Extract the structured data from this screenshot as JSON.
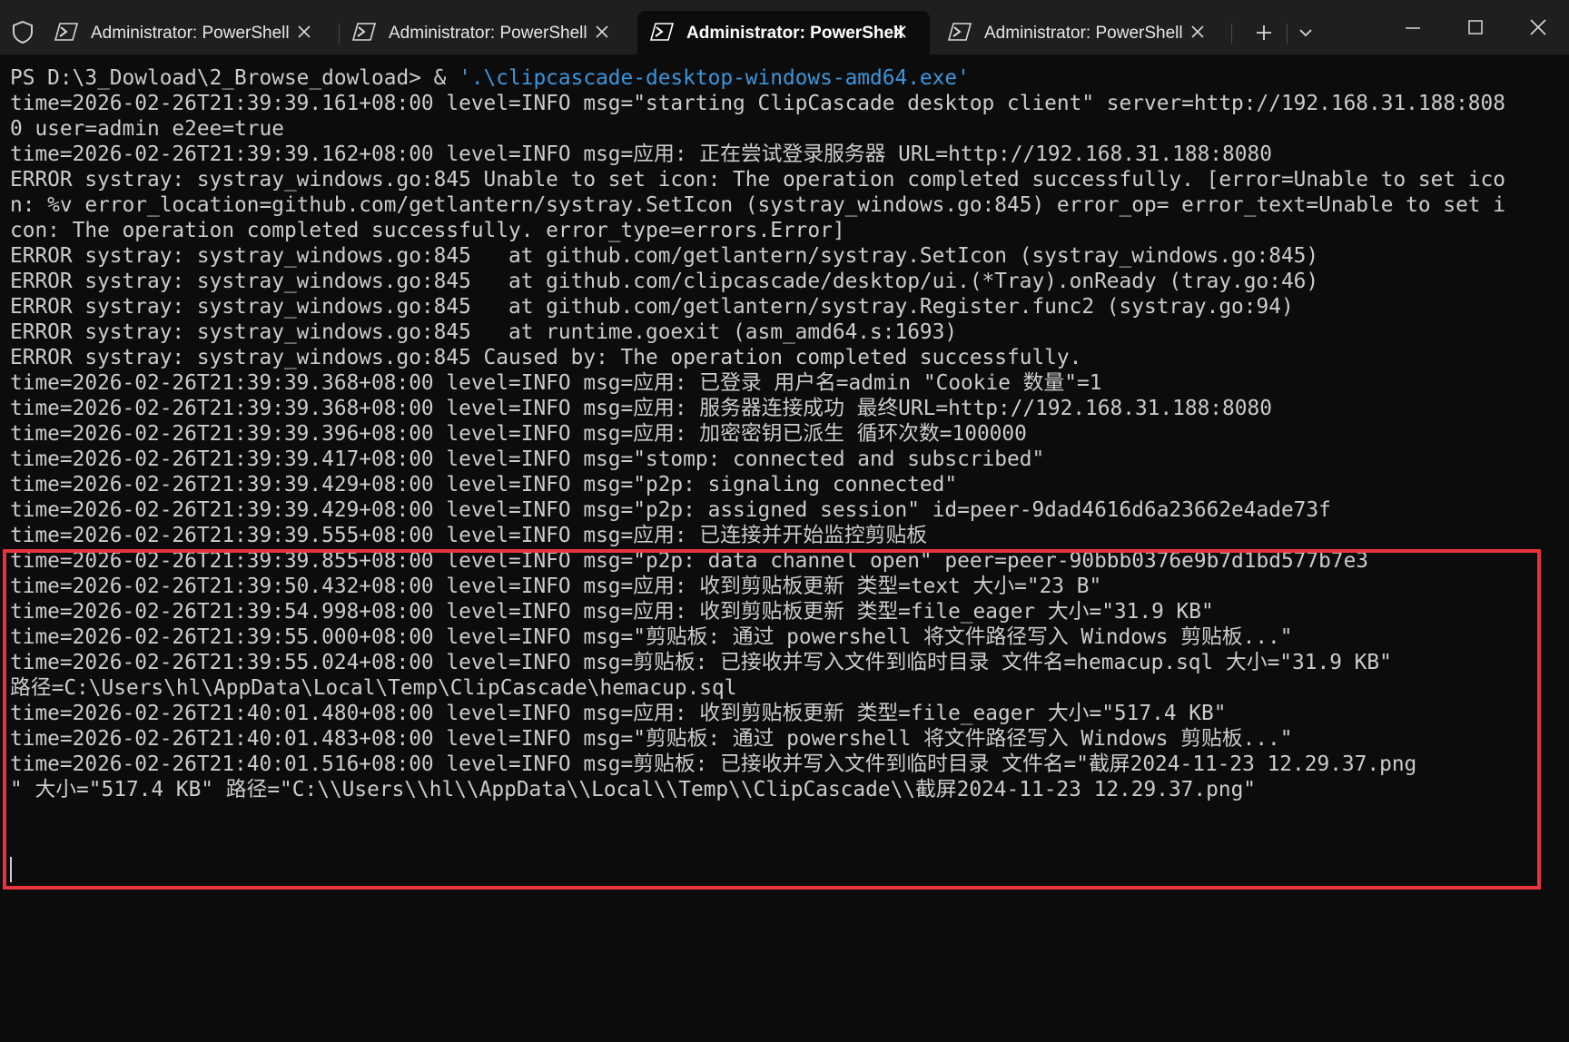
{
  "window": {
    "tabs": [
      {
        "label": "Administrator: PowerShell",
        "active": false
      },
      {
        "label": "Administrator: PowerShell",
        "active": false
      },
      {
        "label": "Administrator: PowerShell",
        "active": true
      },
      {
        "label": "Administrator: PowerShell",
        "active": false
      }
    ],
    "icons": {
      "shield": "shield-icon",
      "tab_icon": "powershell-icon",
      "close": "close-icon",
      "new_tab": "plus-icon",
      "dropdown": "chevron-down-icon",
      "minimize": "minimize-icon",
      "maximize": "maximize-icon",
      "close_window": "close-icon"
    },
    "colors": {
      "titlebar": "#1f1f1f",
      "terminal_bg": "#0c0c0c",
      "text": "#cccccc",
      "command_arg": "#3a96dd",
      "highlight_border": "#e5343d"
    }
  },
  "terminal": {
    "prompt": "PS D:\\3_Dowload\\2_Browse_dowload> & ",
    "command_arg": "'.\\clipcascade-desktop-windows-amd64.exe'",
    "lines": [
      "time=2026-02-26T21:39:39.161+08:00 level=INFO msg=\"starting ClipCascade desktop client\" server=http://192.168.31.188:808",
      "0 user=admin e2ee=true",
      "time=2026-02-26T21:39:39.162+08:00 level=INFO msg=应用: 正在尝试登录服务器 URL=http://192.168.31.188:8080",
      "ERROR systray: systray_windows.go:845 Unable to set icon: The operation completed successfully. [error=Unable to set ico",
      "n: %v error_location=github.com/getlantern/systray.SetIcon (systray_windows.go:845) error_op= error_text=Unable to set i",
      "con: The operation completed successfully. error_type=errors.Error]",
      "ERROR systray: systray_windows.go:845   at github.com/getlantern/systray.SetIcon (systray_windows.go:845)",
      "ERROR systray: systray_windows.go:845   at github.com/clipcascade/desktop/ui.(*Tray).onReady (tray.go:46)",
      "ERROR systray: systray_windows.go:845   at github.com/getlantern/systray.Register.func2 (systray.go:94)",
      "ERROR systray: systray_windows.go:845   at runtime.goexit (asm_amd64.s:1693)",
      "ERROR systray: systray_windows.go:845 Caused by: The operation completed successfully.",
      "time=2026-02-26T21:39:39.368+08:00 level=INFO msg=应用: 已登录 用户名=admin \"Cookie 数量\"=1",
      "time=2026-02-26T21:39:39.368+08:00 level=INFO msg=应用: 服务器连接成功 最终URL=http://192.168.31.188:8080",
      "time=2026-02-26T21:39:39.396+08:00 level=INFO msg=应用: 加密密钥已派生 循环次数=100000",
      "time=2026-02-26T21:39:39.417+08:00 level=INFO msg=\"stomp: connected and subscribed\"",
      "time=2026-02-26T21:39:39.429+08:00 level=INFO msg=\"p2p: signaling connected\"",
      "time=2026-02-26T21:39:39.429+08:00 level=INFO msg=\"p2p: assigned session\" id=peer-9dad4616d6a23662e4ade73f",
      "time=2026-02-26T21:39:39.555+08:00 level=INFO msg=应用: 已连接并开始监控剪贴板",
      "time=2026-02-26T21:39:39.855+08:00 level=INFO msg=\"p2p: data channel open\" peer=peer-90bbb0376e9b7d1bd577b7e3",
      "time=2026-02-26T21:39:50.432+08:00 level=INFO msg=应用: 收到剪贴板更新 类型=text 大小=\"23 B\"",
      "time=2026-02-26T21:39:54.998+08:00 level=INFO msg=应用: 收到剪贴板更新 类型=file_eager 大小=\"31.9 KB\"",
      "time=2026-02-26T21:39:55.000+08:00 level=INFO msg=\"剪贴板: 通过 powershell 将文件路径写入 Windows 剪贴板...\"",
      "time=2026-02-26T21:39:55.024+08:00 level=INFO msg=剪贴板: 已接收并写入文件到临时目录 文件名=hemacup.sql 大小=\"31.9 KB\"",
      "路径=C:\\Users\\hl\\AppData\\Local\\Temp\\ClipCascade\\hemacup.sql",
      "time=2026-02-26T21:40:01.480+08:00 level=INFO msg=应用: 收到剪贴板更新 类型=file_eager 大小=\"517.4 KB\"",
      "time=2026-02-26T21:40:01.483+08:00 level=INFO msg=\"剪贴板: 通过 powershell 将文件路径写入 Windows 剪贴板...\"",
      "time=2026-02-26T21:40:01.516+08:00 level=INFO msg=剪贴板: 已接收并写入文件到临时目录 文件名=\"截屏2024-11-23 12.29.37.png",
      "\" 大小=\"517.4 KB\" 路径=\"C:\\\\Users\\\\hl\\\\AppData\\\\Local\\\\Temp\\\\ClipCascade\\\\截屏2024-11-23 12.29.37.png\""
    ]
  }
}
